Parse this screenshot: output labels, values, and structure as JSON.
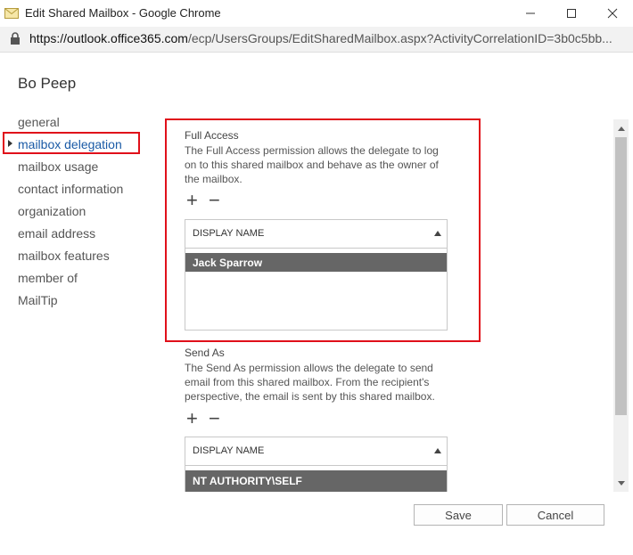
{
  "window": {
    "title": "Edit Shared Mailbox - Google Chrome",
    "url_domain": "https://outlook.office365.com",
    "url_path": "/ecp/UsersGroups/EditSharedMailbox.aspx?ActivityCorrelationID=3b0c5bb..."
  },
  "page_title": "Bo Peep",
  "nav": {
    "items": [
      {
        "label": "general",
        "active": false
      },
      {
        "label": "mailbox delegation",
        "active": true
      },
      {
        "label": "mailbox usage",
        "active": false
      },
      {
        "label": "contact information",
        "active": false
      },
      {
        "label": "organization",
        "active": false
      },
      {
        "label": "email address",
        "active": false
      },
      {
        "label": "mailbox features",
        "active": false
      },
      {
        "label": "member of",
        "active": false
      },
      {
        "label": "MailTip",
        "active": false
      }
    ]
  },
  "full_access": {
    "label": "Full Access",
    "description": "The Full Access permission allows the delegate to log on to this shared mailbox and behave as the owner of the mailbox.",
    "column_header": "DISPLAY NAME",
    "rows": [
      "Jack Sparrow"
    ]
  },
  "send_as": {
    "label": "Send As",
    "description": "The Send As permission allows the delegate to send email from this shared mailbox. From the recipient's perspective, the email is sent by this shared mailbox.",
    "column_header": "DISPLAY NAME",
    "rows": [
      "NT AUTHORITY\\SELF"
    ]
  },
  "toolbar": {
    "add_symbol": "+",
    "remove_symbol": "−"
  },
  "buttons": {
    "save": "Save",
    "cancel": "Cancel"
  },
  "colors": {
    "highlight_border": "#e0101a",
    "active_nav": "#1a5aa6",
    "selected_row": "#666666"
  }
}
